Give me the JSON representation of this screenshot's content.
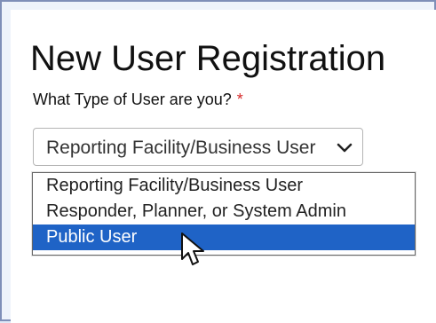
{
  "form": {
    "title": "New User Registration",
    "prompt": "What Type of User are you?",
    "required_marker": "*",
    "selected_value": "Reporting Facility/Business User",
    "options": [
      "Reporting Facility/Business User",
      "Responder, Planner, or System Admin",
      "Public User"
    ],
    "highlighted_option_index": 2
  },
  "icons": {
    "dropdown_arrow": "chevron-down-icon",
    "pointer": "mouse-pointer-icon"
  },
  "colors": {
    "accent": "#1f63c6",
    "required": "#d62828",
    "text": "#111111",
    "select_border": "#b5b5b5",
    "dropdown_border": "#666666"
  }
}
